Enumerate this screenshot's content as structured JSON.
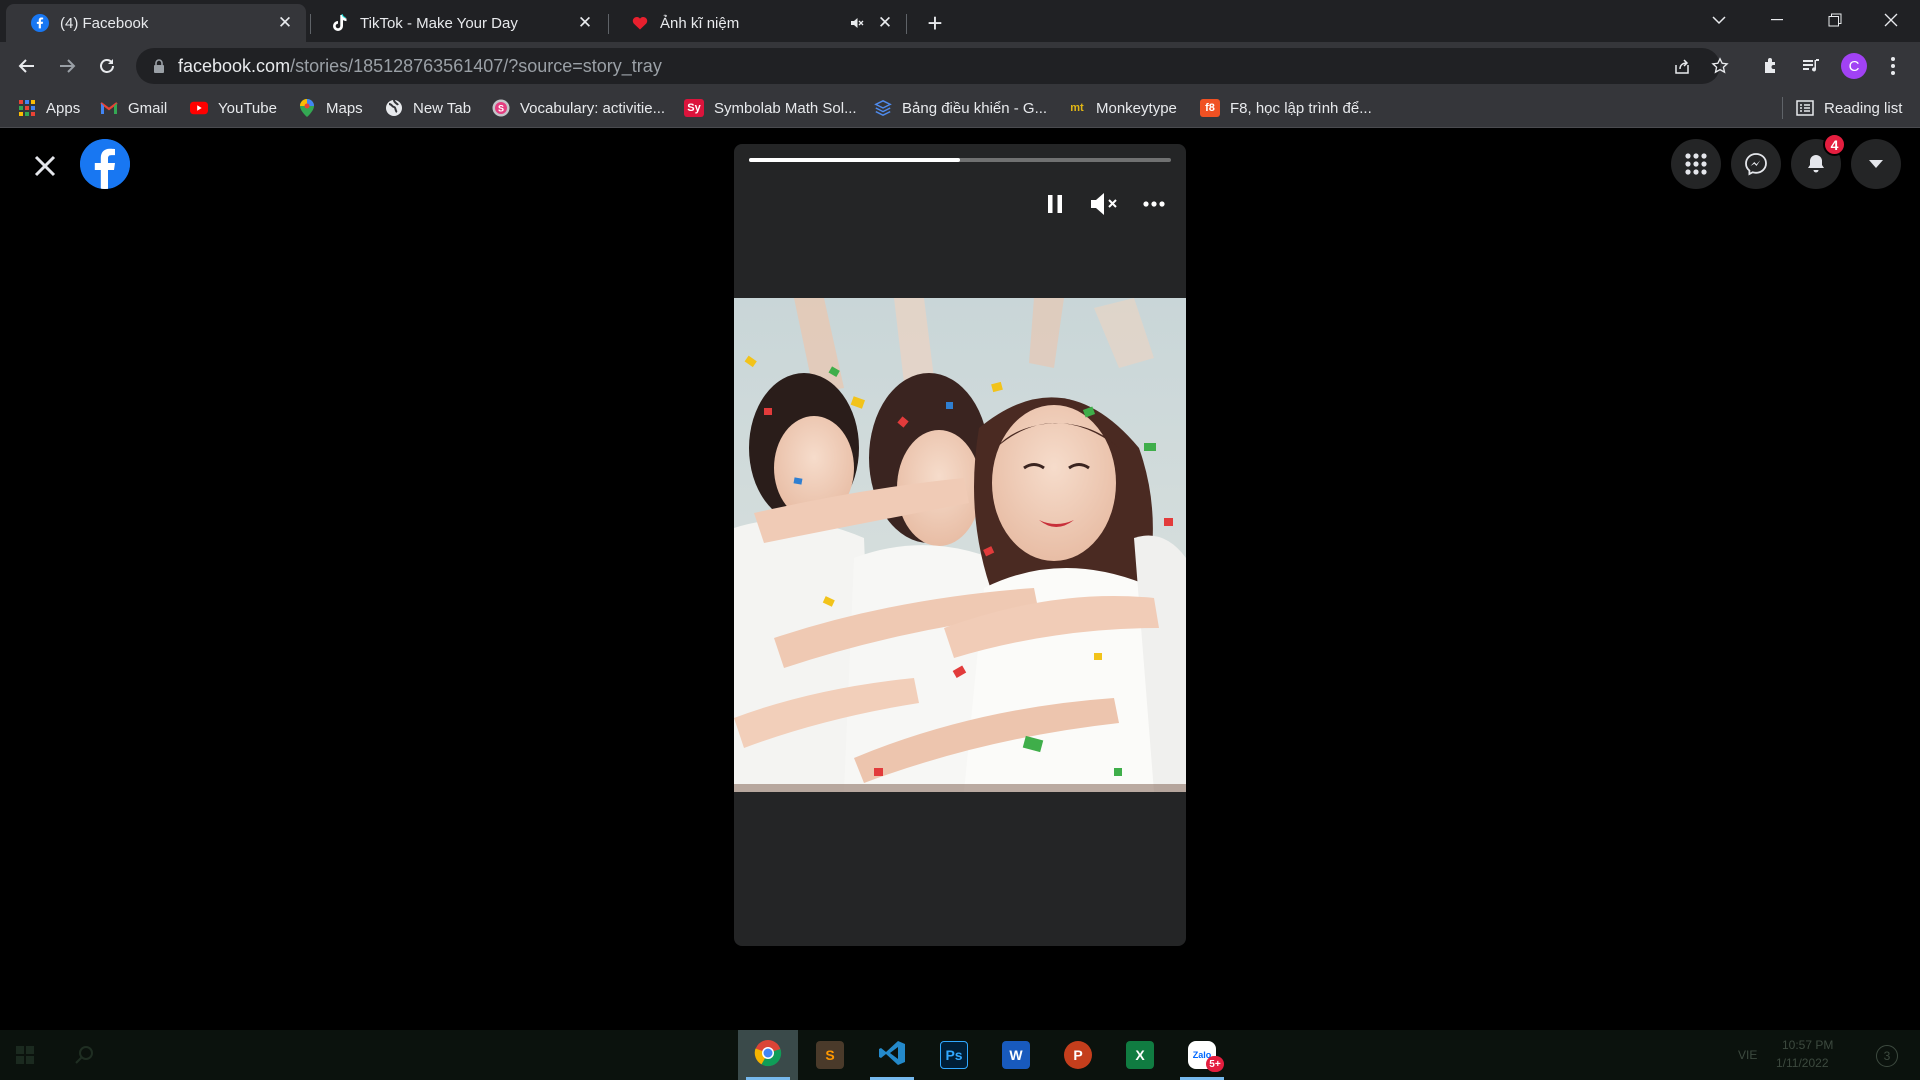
{
  "tabs": [
    {
      "title": "(4) Facebook",
      "icon": "facebook-icon",
      "active": true
    },
    {
      "title": "TikTok - Make Your Day",
      "icon": "tiktok-icon",
      "active": false
    },
    {
      "title": "Ảnh kĩ niệm",
      "icon": "heart-icon",
      "active": false,
      "audio": "muted"
    }
  ],
  "address_bar": {
    "domain": "facebook.com",
    "path": "/stories/185128763561407/?source=story_tray"
  },
  "bookmarks": [
    {
      "label": "Apps",
      "icon": "apps-grid-icon"
    },
    {
      "label": "Gmail",
      "icon": "gmail-icon"
    },
    {
      "label": "YouTube",
      "icon": "youtube-icon"
    },
    {
      "label": "Maps",
      "icon": "maps-icon"
    },
    {
      "label": "New Tab",
      "icon": "globe-icon"
    },
    {
      "label": "Vocabulary: activitie...",
      "icon": "vocabulary-icon"
    },
    {
      "label": "Symbolab Math Sol...",
      "icon": "symbolab-icon",
      "icon_text": "Sy"
    },
    {
      "label": "Bảng điều khiển - G...",
      "icon": "stack-icon"
    },
    {
      "label": "Monkeytype",
      "icon": "monkeytype-icon",
      "icon_text": "mt"
    },
    {
      "label": "F8, học lập trình để...",
      "icon": "f8-icon",
      "icon_text": "f8"
    }
  ],
  "reading_list": "Reading list",
  "profile_initial": "C",
  "facebook": {
    "notifications_count": "4",
    "story_progress": 0.5
  },
  "taskbar": {
    "apps": [
      {
        "name": "chrome",
        "active": true
      },
      {
        "name": "sublime-text",
        "label": "S"
      },
      {
        "name": "vscode"
      },
      {
        "name": "photoshop",
        "label": "Ps"
      },
      {
        "name": "word",
        "label": "W"
      },
      {
        "name": "powerpoint",
        "label": "P"
      },
      {
        "name": "excel",
        "label": "X"
      },
      {
        "name": "zalo",
        "label": "Zalo",
        "badge": "5+"
      }
    ],
    "clock_time": "10:57 PM",
    "clock_date": "1/11/2022",
    "notification_count": "3",
    "language": "VIE"
  },
  "colors": {
    "facebook_blue": "#1877f2",
    "notification_red": "#e41e3f",
    "chrome_dark": "#202124",
    "chrome_toolbar": "#35363a"
  }
}
